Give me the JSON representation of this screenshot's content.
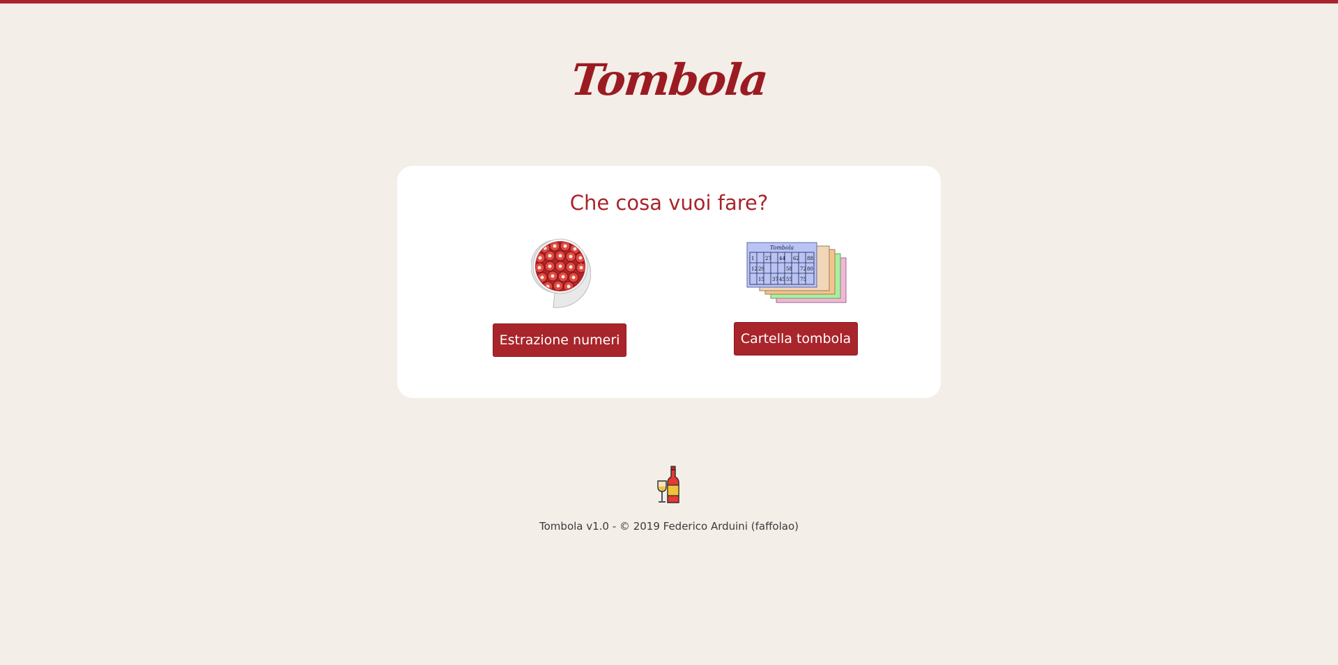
{
  "header": {
    "logo_text": "Tombola",
    "accent_color": "#a8252b"
  },
  "card": {
    "title": "Che cosa vuoi fare?",
    "options": [
      {
        "label": "Estrazione numeri",
        "icon": "bingo-bowl-icon"
      },
      {
        "label": "Cartella tombola",
        "icon": "tombola-cards-icon"
      }
    ],
    "cartella_preview": {
      "header": "Tombola",
      "row1": [
        "1",
        "27",
        "44",
        "62",
        "88"
      ],
      "row2": [
        "12",
        "29",
        "58",
        "72",
        "80"
      ],
      "row3": [
        "15",
        "37",
        "45",
        "55",
        "75"
      ]
    }
  },
  "footer": {
    "icon": "wine-bottle-icon",
    "text": "Tombola v1.0 - © 2019 Federico Arduini (faffolao)"
  },
  "colors": {
    "background": "#f3eee8",
    "card": "#ffffff",
    "button": "#a8252b"
  }
}
